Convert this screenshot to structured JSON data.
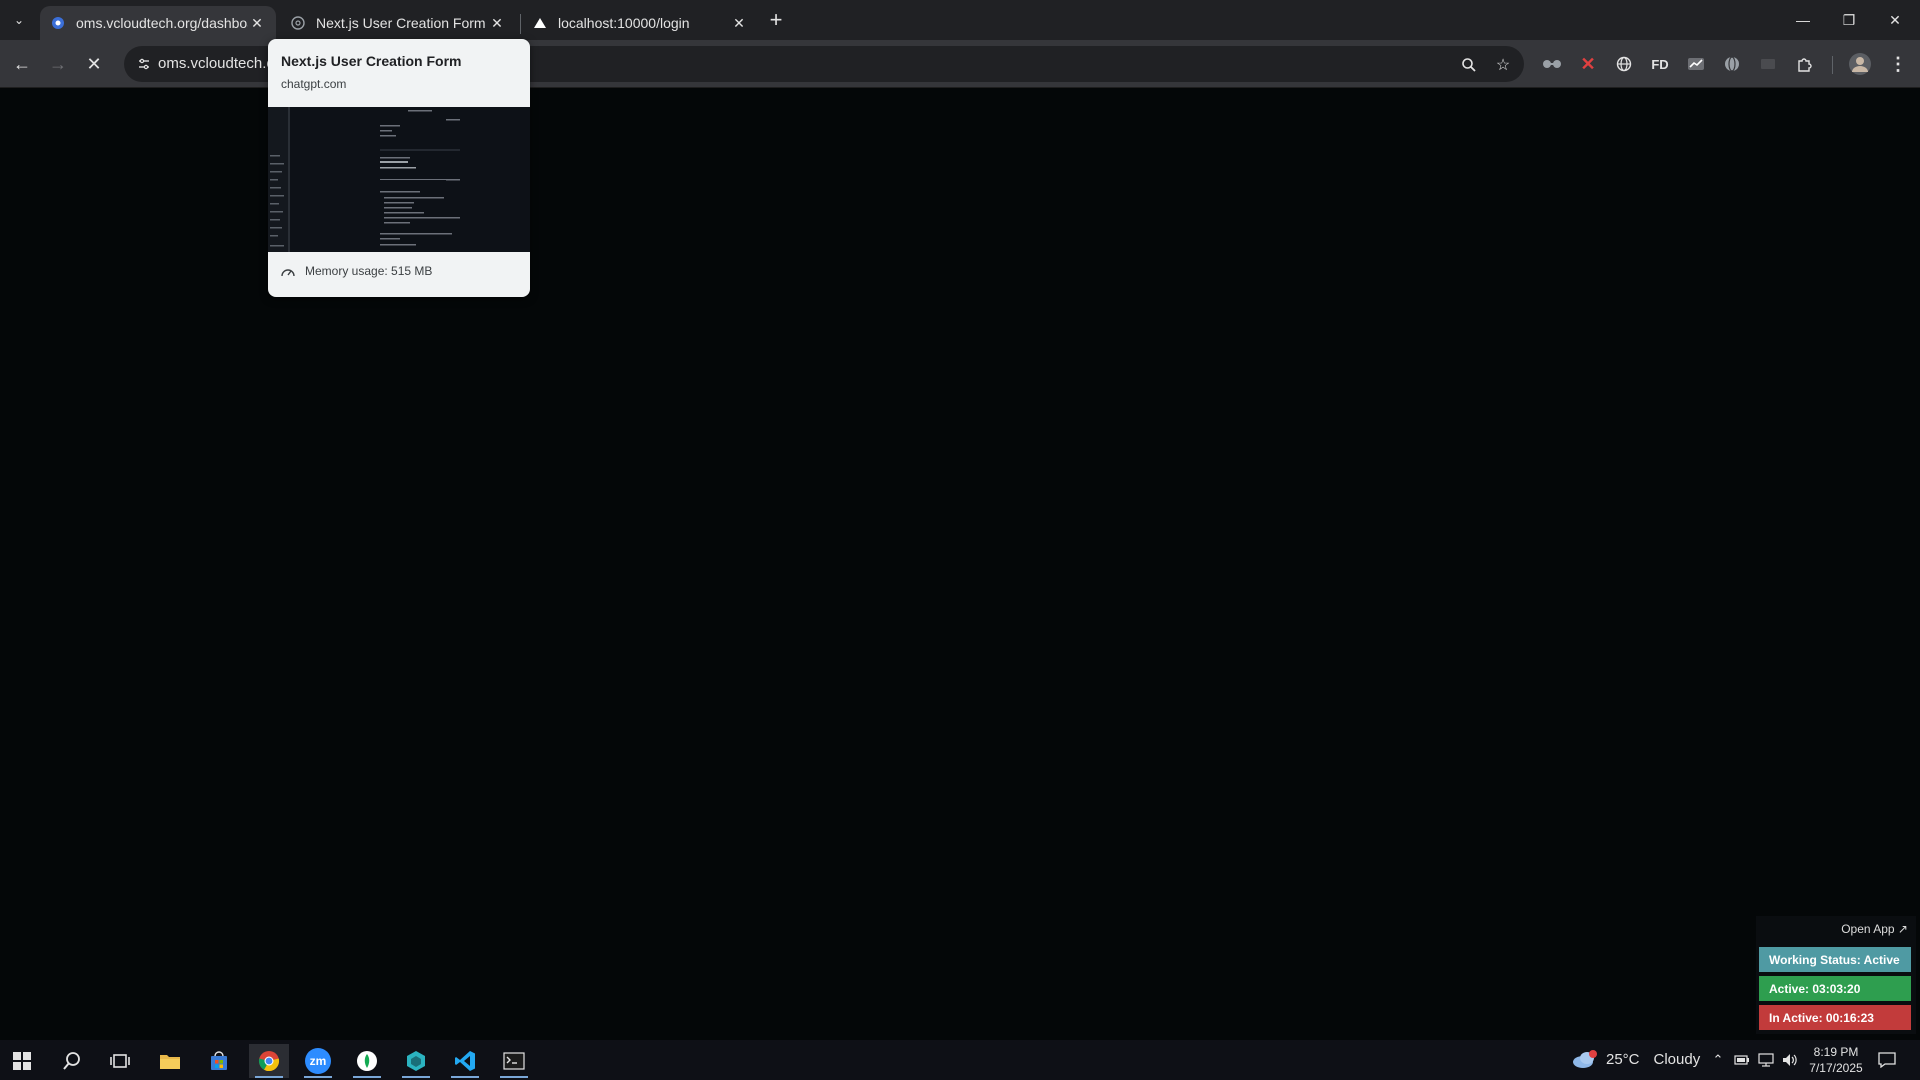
{
  "browser": {
    "tabs": [
      {
        "title": "oms.vcloudtech.org/dashboard",
        "favicon": "oms-icon",
        "active": true
      },
      {
        "title": "Next.js User Creation Form",
        "favicon": "chatgpt-icon",
        "active": false
      },
      {
        "title": "localhost:10000/login",
        "favicon": "vercel-triangle-icon",
        "active": false
      }
    ],
    "address_bar": {
      "url": "oms.vcloudtech.o"
    },
    "hover_card": {
      "title": "Next.js User Creation Form",
      "domain": "chatgpt.com",
      "memory": "Memory usage: 515 MB"
    },
    "extensions": [
      "glasses-ext-icon",
      "red-x-ext-icon",
      "globe-ext-icon",
      "fd-ext-icon",
      "chart-ext-icon",
      "globe-alt-ext-icon",
      "disabled-ext-icon",
      "puzzle-icon"
    ],
    "extension_labels": {
      "fd": "FD"
    }
  },
  "status_widget": {
    "open_app": "Open App ↗",
    "working_status": "Working Status: Active",
    "active_time": "Active: 03:03:20",
    "inactive_time": "In Active: 00:16:23",
    "colors": {
      "working": "#4f9aa3",
      "active": "#2e9e4f",
      "inactive": "#c23b3b"
    }
  },
  "taskbar": {
    "apps": [
      "windows-start-icon",
      "search-icon",
      "task-view-icon",
      "file-explorer-icon",
      "store-icon",
      "chrome-icon",
      "zoom-icon",
      "mongodb-compass-icon",
      "app-hexagon-icon",
      "vscode-icon",
      "terminal-icon"
    ],
    "zoom_label": "zm",
    "weather": {
      "temp": "25°C",
      "condition": "Cloudy"
    },
    "clock": {
      "time": "8:19 PM",
      "date": "7/17/2025"
    }
  }
}
